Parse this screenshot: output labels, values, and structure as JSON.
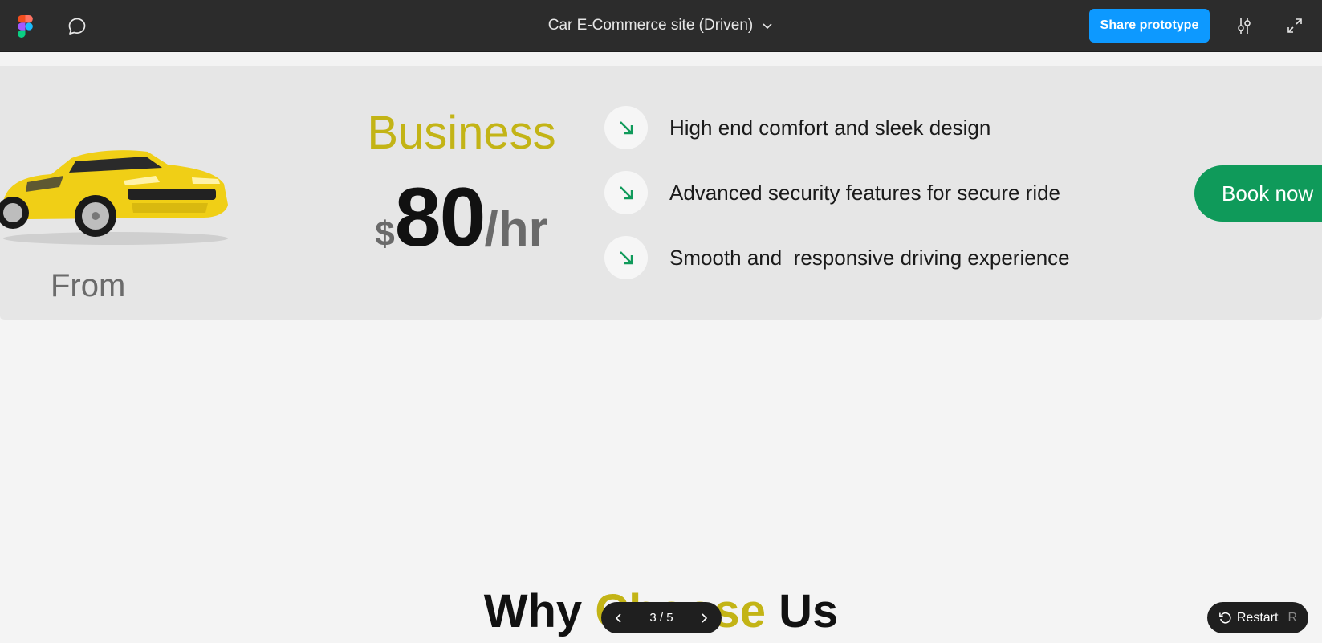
{
  "topbar": {
    "file_title": "Car E-Commerce site (Driven)",
    "share_label": "Share prototype",
    "icons": [
      "figma-logo",
      "comment-icon",
      "chevron-down-icon",
      "settings-sliders-icon",
      "expand-icon"
    ]
  },
  "banner": {
    "from_label": "From",
    "plan_name": "Business",
    "price": {
      "currency": "$",
      "amount": "80",
      "unit": "/hr"
    },
    "features": [
      "High end comfort and sleek design",
      "Advanced security features for secure ride",
      "Smooth and  responsive driving experience"
    ],
    "book_label": "Book now"
  },
  "section": {
    "why_part1": "Why ",
    "why_accent": "Choose",
    "why_part2": " Us"
  },
  "pager": {
    "current": "3 / 5"
  },
  "restart": {
    "label": "Restart",
    "shortcut": "R"
  },
  "colors": {
    "accent_yellow": "#c3b416",
    "book_green": "#0f9a5a",
    "share_blue": "#0d99ff"
  }
}
